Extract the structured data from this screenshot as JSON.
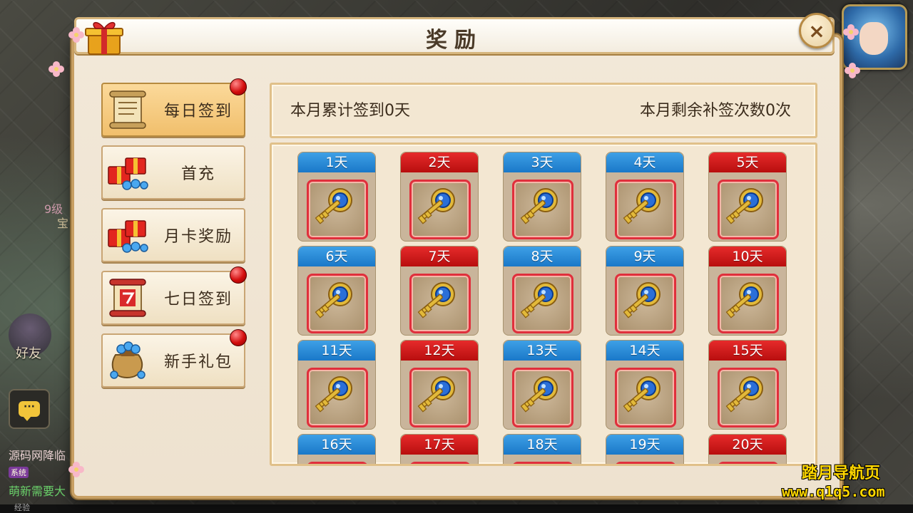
{
  "window": {
    "title": "奖励"
  },
  "close_icon_label": "×",
  "colors": {
    "blue_header": "#1a78c8",
    "red_header": "#b80e0e",
    "badge": "#d30d0d",
    "active_menu": "#f1bf6c"
  },
  "menu": [
    {
      "label": "每日签到",
      "icon": "scroll-icon",
      "active": true,
      "badge": true
    },
    {
      "label": "首充",
      "icon": "gift-gems-icon",
      "active": false,
      "badge": false
    },
    {
      "label": "月卡奖励",
      "icon": "gift-gems-icon",
      "active": false,
      "badge": false
    },
    {
      "label": "七日签到",
      "icon": "seven-scroll-icon",
      "active": false,
      "badge": true
    },
    {
      "label": "新手礼包",
      "icon": "gem-bag-icon",
      "active": false,
      "badge": true
    }
  ],
  "stats": {
    "total_signed": "本月累计签到0天",
    "remaining_makeup": "本月剩余补签次数0次"
  },
  "days": [
    {
      "label": "1天",
      "color": "blue",
      "item": "golden-key-icon"
    },
    {
      "label": "2天",
      "color": "red",
      "item": "golden-key-icon"
    },
    {
      "label": "3天",
      "color": "blue",
      "item": "golden-key-icon"
    },
    {
      "label": "4天",
      "color": "blue",
      "item": "golden-key-icon"
    },
    {
      "label": "5天",
      "color": "red",
      "item": "golden-key-icon"
    },
    {
      "label": "6天",
      "color": "blue",
      "item": "golden-key-icon"
    },
    {
      "label": "7天",
      "color": "red",
      "item": "golden-key-icon"
    },
    {
      "label": "8天",
      "color": "blue",
      "item": "golden-key-icon"
    },
    {
      "label": "9天",
      "color": "blue",
      "item": "golden-key-icon"
    },
    {
      "label": "10天",
      "color": "red",
      "item": "golden-key-icon"
    },
    {
      "label": "11天",
      "color": "blue",
      "item": "golden-key-icon"
    },
    {
      "label": "12天",
      "color": "red",
      "item": "golden-key-icon"
    },
    {
      "label": "13天",
      "color": "blue",
      "item": "golden-key-icon"
    },
    {
      "label": "14天",
      "color": "blue",
      "item": "golden-key-icon"
    },
    {
      "label": "15天",
      "color": "red",
      "item": "golden-key-icon"
    },
    {
      "label": "16天",
      "color": "blue",
      "item": "golden-key-icon"
    },
    {
      "label": "17天",
      "color": "red",
      "item": "golden-key-icon"
    },
    {
      "label": "18天",
      "color": "blue",
      "item": "golden-key-icon"
    },
    {
      "label": "19天",
      "color": "blue",
      "item": "golden-key-icon"
    },
    {
      "label": "20天",
      "color": "red",
      "item": "golden-key-icon"
    }
  ],
  "background": {
    "friend_label": "好友",
    "chat_lines": [
      {
        "tag": "",
        "text": "源码网降临"
      },
      {
        "tag": "系统",
        "text": ""
      },
      {
        "tag": "",
        "text": "萌新需要大"
      }
    ],
    "exp_label": "经验",
    "side_text_1": "9级",
    "side_text_2": "宝"
  },
  "watermark": {
    "line1": "踏月导航页",
    "line2": "www.q1q5.com"
  }
}
